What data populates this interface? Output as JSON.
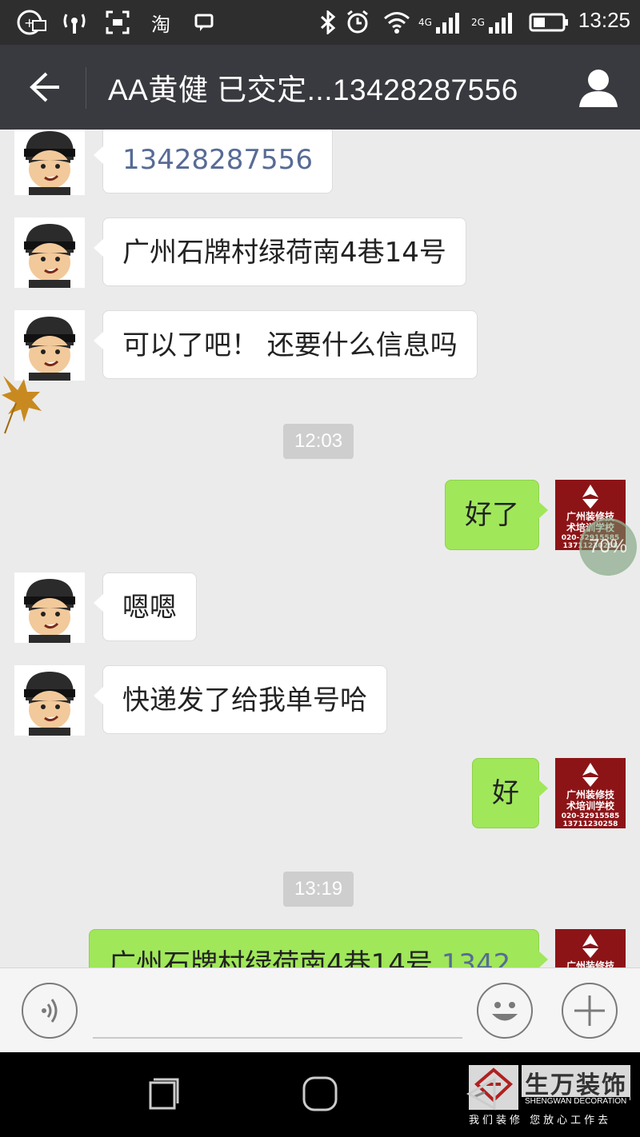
{
  "status_bar": {
    "time": "13:25",
    "network_2g_label": "2G",
    "network_4g_label": "4G"
  },
  "header": {
    "title": "AA黄健  已交定...13428287556"
  },
  "messages": [
    {
      "side": "in",
      "text": "13428287556",
      "is_link": true
    },
    {
      "side": "in",
      "text": "广州石牌村绿荷南4巷14号"
    },
    {
      "side": "in",
      "text": "可以了吧！  还要什么信息吗"
    },
    {
      "type": "time",
      "text": "12:03"
    },
    {
      "side": "out",
      "text": "好了",
      "upload_progress": "70%"
    },
    {
      "side": "in",
      "text": "嗯嗯"
    },
    {
      "side": "in",
      "text": "快递发了给我单号哈"
    },
    {
      "side": "out",
      "text": "好"
    },
    {
      "type": "time",
      "text": "13:19"
    },
    {
      "side": "out",
      "text": "广州石牌村绿荷南4巷14号",
      "link_tail": "1342"
    }
  ],
  "avatars": {
    "self_logo_line1": "广州装修技",
    "self_logo_line2": "术培训学校",
    "self_logo_phone1": "020-32915585",
    "self_logo_phone2": "13711230258"
  },
  "input": {
    "placeholder": ""
  },
  "watermark": {
    "brand": "生万装饰",
    "english": "SHENGWAN DECORATION",
    "slogan": "我们装修  您放心工作去"
  },
  "colors": {
    "title_bar": "#393a3f",
    "out_bubble": "#a0e75a",
    "in_bubble": "#ffffff",
    "link": "#576b95",
    "background": "#ebebeb"
  },
  "icons": [
    "back-arrow-icon",
    "profile-icon",
    "voice-icon",
    "emoji-icon",
    "plus-icon",
    "recent-apps-icon",
    "home-icon",
    "back-triangle-icon"
  ]
}
